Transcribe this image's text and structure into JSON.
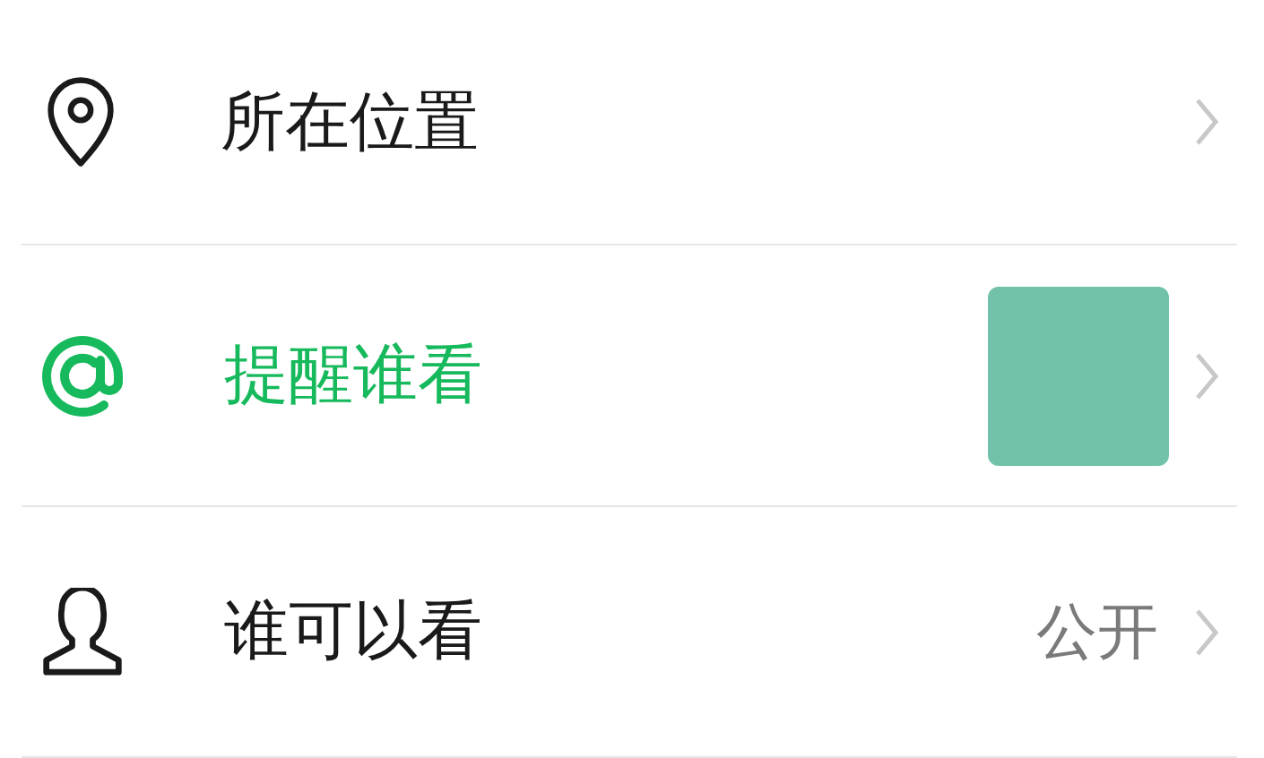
{
  "rows": [
    {
      "kind": "location",
      "label": "所在位置",
      "highlighted": false
    },
    {
      "kind": "mention",
      "label": "提醒谁看",
      "highlighted": true,
      "thumbnail": true
    },
    {
      "kind": "visibility",
      "label": "谁可以看",
      "highlighted": false,
      "value": "公开"
    }
  ]
}
